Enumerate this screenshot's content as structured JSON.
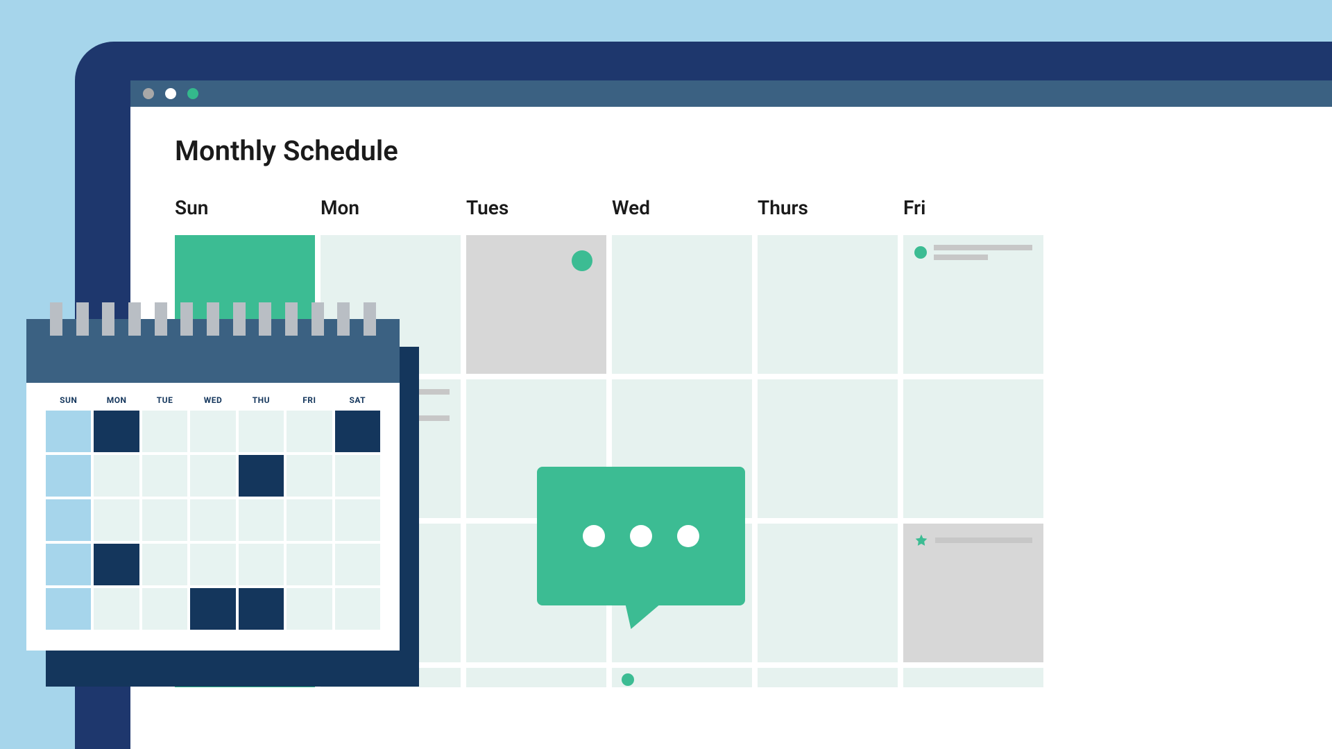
{
  "page_title": "Monthly Schedule",
  "month_headers": [
    "Sun",
    "Mon",
    "Tues",
    "Wed",
    "Thurs",
    "Fri"
  ],
  "mini_headers": [
    "SUN",
    "MON",
    "TUE",
    "WED",
    "THU",
    "FRI",
    "SAT"
  ],
  "colors": {
    "accent_green": "#3cbc93",
    "cell_muted": "#e6f2ef",
    "cell_grey": "#d7d7d7",
    "navy": "#1e376d",
    "slate": "#3b6182",
    "sky": "#a6d5eb",
    "mini_dark": "#14365c"
  },
  "main_calendar": [
    [
      {
        "type": "green"
      },
      {
        "type": "muted"
      },
      {
        "type": "grey",
        "dot": true
      },
      {
        "type": "muted"
      },
      {
        "type": "muted"
      },
      {
        "type": "muted",
        "events": [
          {
            "bullet": "dot",
            "lines": 2
          }
        ]
      }
    ],
    [
      {
        "type": "green"
      },
      {
        "type": "muted",
        "events": [
          {
            "bullet": "dot",
            "lines": 2
          },
          {
            "bullet": "star",
            "lines": 1
          }
        ]
      },
      {
        "type": "muted"
      },
      {
        "type": "muted"
      },
      {
        "type": "muted"
      },
      {
        "type": "muted"
      }
    ],
    [
      {
        "type": "green"
      },
      {
        "type": "muted"
      },
      {
        "type": "muted"
      },
      {
        "type": "muted"
      },
      {
        "type": "muted"
      },
      {
        "type": "grey",
        "events": [
          {
            "bullet": "star",
            "lines": 1
          }
        ]
      }
    ],
    [
      {
        "type": "green"
      },
      {
        "type": "muted"
      },
      {
        "type": "muted"
      },
      {
        "type": "muted",
        "dot_bl": true
      },
      {
        "type": "muted"
      },
      {
        "type": "muted"
      }
    ]
  ],
  "mini_calendar": [
    [
      "blue",
      "dark",
      "muted",
      "muted",
      "muted",
      "muted",
      "dark"
    ],
    [
      "blue",
      "muted",
      "muted",
      "muted",
      "dark",
      "muted",
      "muted"
    ],
    [
      "blue",
      "muted",
      "muted",
      "muted",
      "muted",
      "muted",
      "muted"
    ],
    [
      "blue",
      "dark",
      "muted",
      "muted",
      "muted",
      "muted",
      "muted"
    ],
    [
      "blue",
      "muted",
      "muted",
      "dark",
      "dark",
      "muted",
      "muted"
    ]
  ]
}
